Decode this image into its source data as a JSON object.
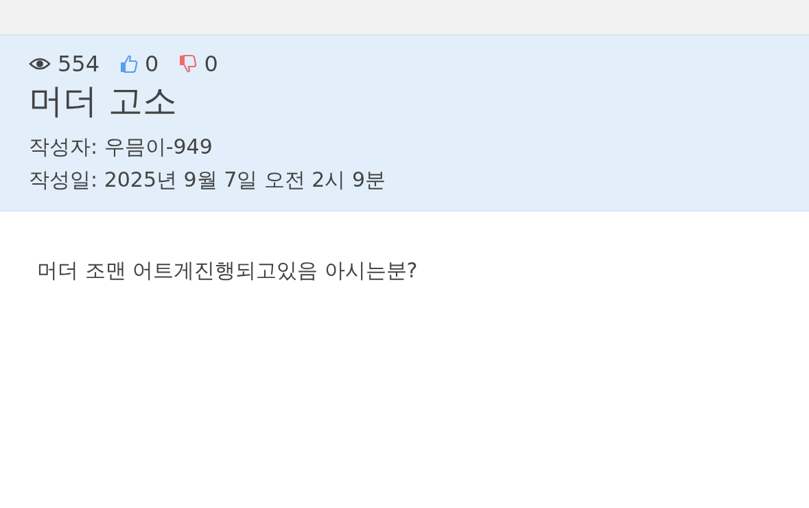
{
  "stats": {
    "views": "554",
    "likes": "0",
    "dislikes": "0"
  },
  "post": {
    "title": "머더 고소",
    "author": "작성자: 우믐이-949",
    "date": "작성일: 2025년 9월 7일 오전 2시 9분",
    "body": "머더 조맨 어트게진행되고있음 아시는분?"
  }
}
